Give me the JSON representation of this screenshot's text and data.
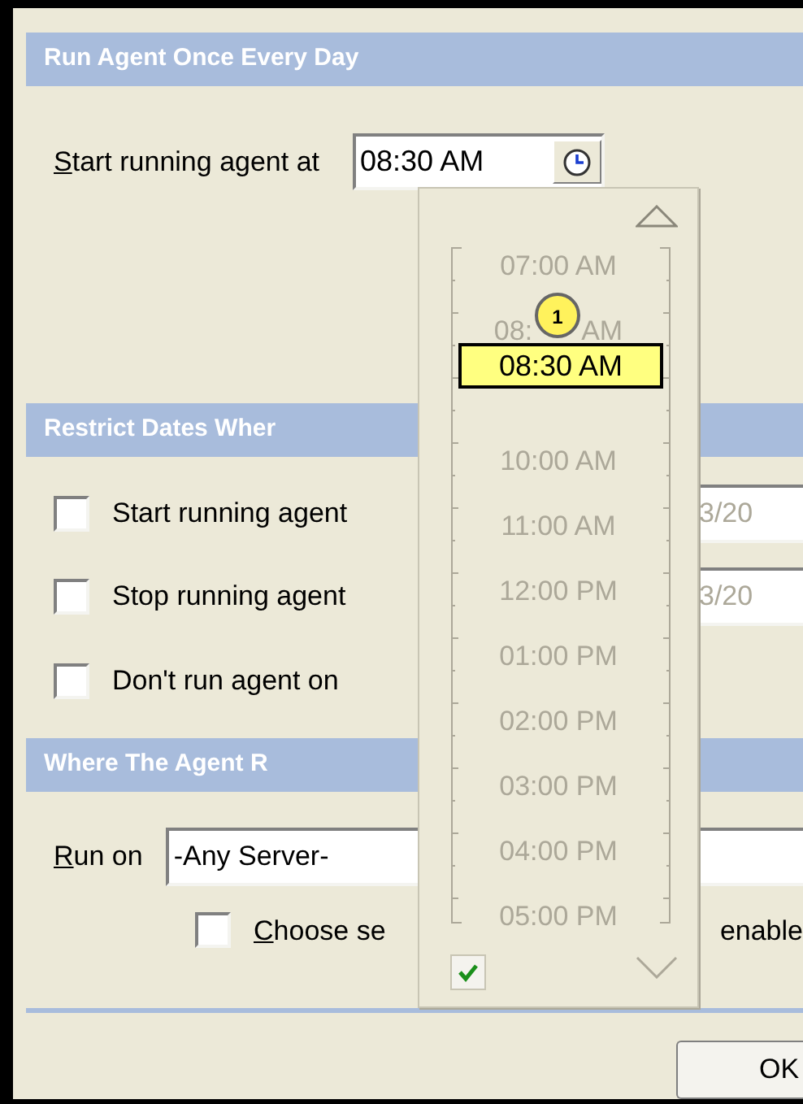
{
  "schedule": {
    "header": "Run Agent Once Every Day",
    "label": "Start running agent at",
    "mnemonic": true,
    "time_value": "08:30 AM"
  },
  "restrict": {
    "header": "Restrict Dates Wher",
    "options": [
      {
        "label": "Start running agent",
        "checked": false,
        "date": "3/20"
      },
      {
        "label": "Stop running agent",
        "checked": false,
        "date": "3/20"
      },
      {
        "label": "Don't run agent on",
        "checked": false
      }
    ]
  },
  "location": {
    "header": "Where The Agent R",
    "label": "Run on",
    "mnemonic": true,
    "server": "-Any Server-",
    "choose": {
      "label": "Choose se",
      "mnemonic": true,
      "checked": false
    },
    "trailing_text": "enable"
  },
  "buttons": [
    "OK"
  ],
  "time_picker": {
    "times": [
      {
        "kind": "full",
        "label": "07:00 AM"
      },
      {
        "kind": "split",
        "parts": [
          "08:",
          "AM"
        ]
      },
      {
        "kind": "covered"
      },
      {
        "kind": "full",
        "label": "10:00 AM"
      },
      {
        "kind": "full",
        "label": "11:00 AM"
      },
      {
        "kind": "full",
        "label": "12:00 PM"
      },
      {
        "kind": "full",
        "label": "01:00 PM"
      },
      {
        "kind": "full",
        "label": "02:00 PM"
      },
      {
        "kind": "full",
        "label": "03:00 PM"
      },
      {
        "kind": "full",
        "label": "04:00 PM"
      },
      {
        "kind": "full",
        "label": "05:00 PM"
      }
    ],
    "selection": "08:30 AM",
    "badge": "1",
    "confirm_checked": true
  }
}
